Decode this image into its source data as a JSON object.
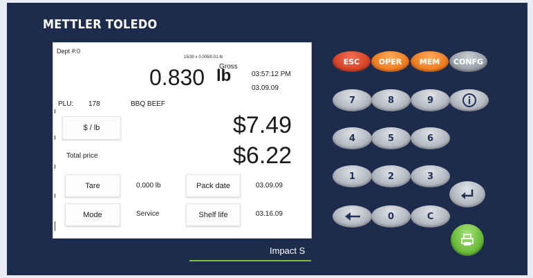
{
  "brand": "METTLER TOLEDO",
  "screen": {
    "dept": "Dept #:0",
    "capacity": "15/30 x 0.005/0.01 lb",
    "weight_value": "0.830",
    "weight_mode": "Gross",
    "weight_unit": "lb",
    "time": "03:57:12 PM",
    "date": "03.09.09",
    "plu_label": "PLU:",
    "plu_number": "178",
    "product_name": "BBQ BEEF",
    "unit_price_button": "$ / lb",
    "unit_price": "$7.49",
    "total_label": "Total price",
    "total_price": "$6.22",
    "tare_button": "Tare",
    "tare_value": "0.000 lb",
    "pack_date_button": "Pack date",
    "pack_date_value": "03.09.09",
    "mode_button": "Mode",
    "mode_value": "Service",
    "shelf_life_button": "Shelf life",
    "shelf_life_value": "03.16.09"
  },
  "keypad": {
    "esc": "ESC",
    "oper": "OPER",
    "mem": "MEM",
    "config": "CONFG",
    "k7": "7",
    "k8": "8",
    "k9": "9",
    "k4": "4",
    "k5": "5",
    "k6": "6",
    "k1": "1",
    "k2": "2",
    "k3": "3",
    "k0": "0",
    "kc": "C"
  },
  "footer": {
    "label": "Impact S"
  },
  "colors": {
    "frame": "#1d2b4d",
    "esc": "#d8452a",
    "oper": "#f07e22",
    "mem": "#f07e22",
    "config": "#9aa0aa",
    "print": "#6cbd3a",
    "accent_line": "#7bc23f"
  },
  "icons": [
    "info-icon",
    "enter-icon",
    "backspace-icon",
    "print-icon"
  ]
}
